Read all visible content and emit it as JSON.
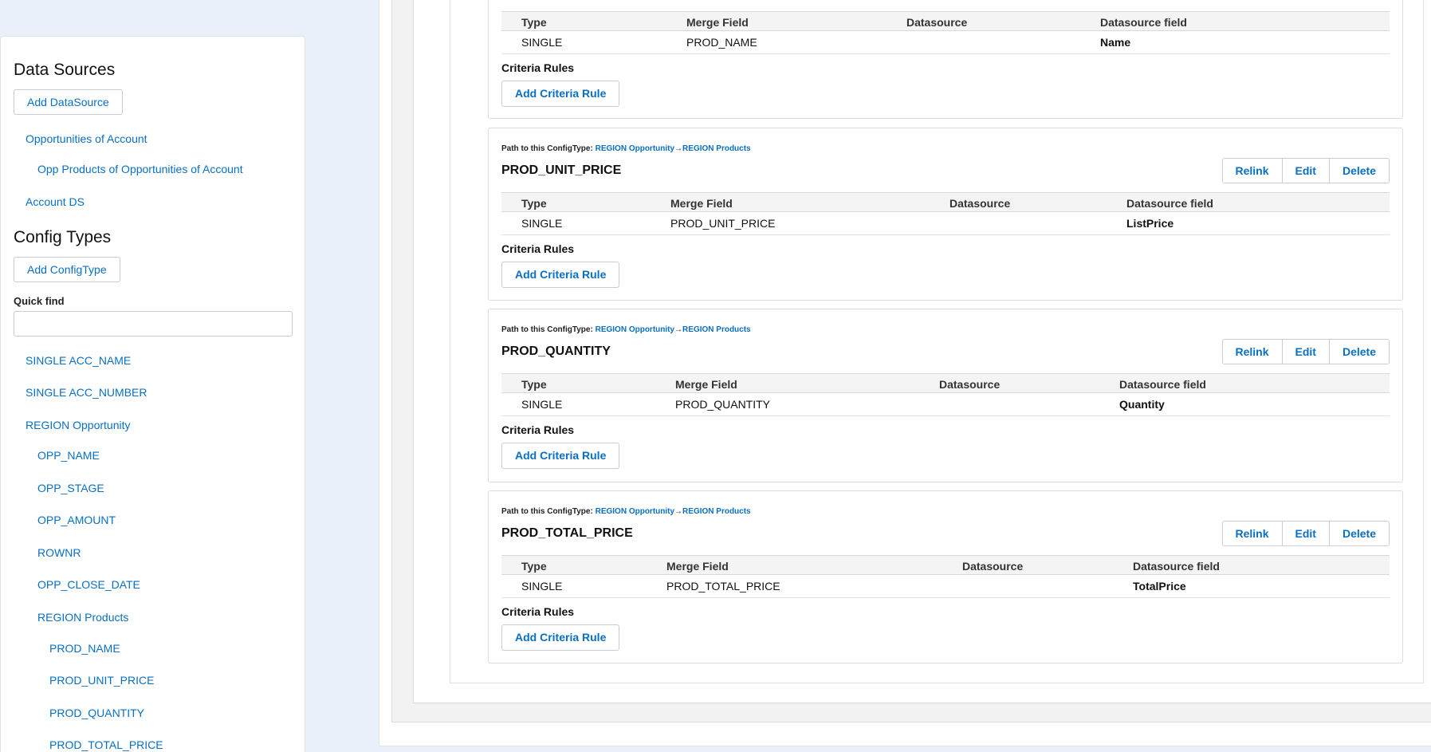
{
  "sidebar": {
    "data_sources_title": "Data Sources",
    "add_datasource_label": "Add DataSource",
    "datasources": [
      {
        "label": "Opportunities of Account"
      },
      {
        "label": "Opp Products of Opportunities of Account"
      },
      {
        "label": "Account DS"
      }
    ],
    "config_types_title": "Config Types",
    "add_configtype_label": "Add ConfigType",
    "quick_find_label": "Quick find",
    "quick_find_value": "",
    "config_items": [
      {
        "label": "SINGLE ACC_NAME"
      },
      {
        "label": "SINGLE ACC_NUMBER"
      },
      {
        "label": "REGION Opportunity"
      },
      {
        "label": "OPP_NAME"
      },
      {
        "label": "OPP_STAGE"
      },
      {
        "label": "OPP_AMOUNT"
      },
      {
        "label": "ROWNR"
      },
      {
        "label": "OPP_CLOSE_DATE"
      },
      {
        "label": "REGION Products"
      },
      {
        "label": "PROD_NAME"
      },
      {
        "label": "PROD_UNIT_PRICE"
      },
      {
        "label": "PROD_QUANTITY"
      },
      {
        "label": "PROD_TOTAL_PRICE"
      }
    ]
  },
  "common": {
    "path_prefix": "Path to this ConfigType:",
    "path_region_opportunity": "REGION Opportunity",
    "path_arrow": "→",
    "path_region_products": "REGION Products",
    "col_type": "Type",
    "col_merge_field": "Merge Field",
    "col_datasource": "Datasource",
    "col_datasource_field": "Datasource field",
    "criteria_rules_label": "Criteria Rules",
    "add_criteria_rule_label": "Add Criteria Rule",
    "relink_label": "Relink",
    "edit_label": "Edit",
    "delete_label": "Delete"
  },
  "cards": [
    {
      "title": "",
      "type": "SINGLE",
      "merge_field": "PROD_NAME",
      "datasource": "",
      "datasource_field": "Name"
    },
    {
      "title": "PROD_UNIT_PRICE",
      "type": "SINGLE",
      "merge_field": "PROD_UNIT_PRICE",
      "datasource": "",
      "datasource_field": "ListPrice"
    },
    {
      "title": "PROD_QUANTITY",
      "type": "SINGLE",
      "merge_field": "PROD_QUANTITY",
      "datasource": "",
      "datasource_field": "Quantity"
    },
    {
      "title": "PROD_TOTAL_PRICE",
      "type": "SINGLE",
      "merge_field": "PROD_TOTAL_PRICE",
      "datasource": "",
      "datasource_field": "TotalPrice"
    }
  ]
}
